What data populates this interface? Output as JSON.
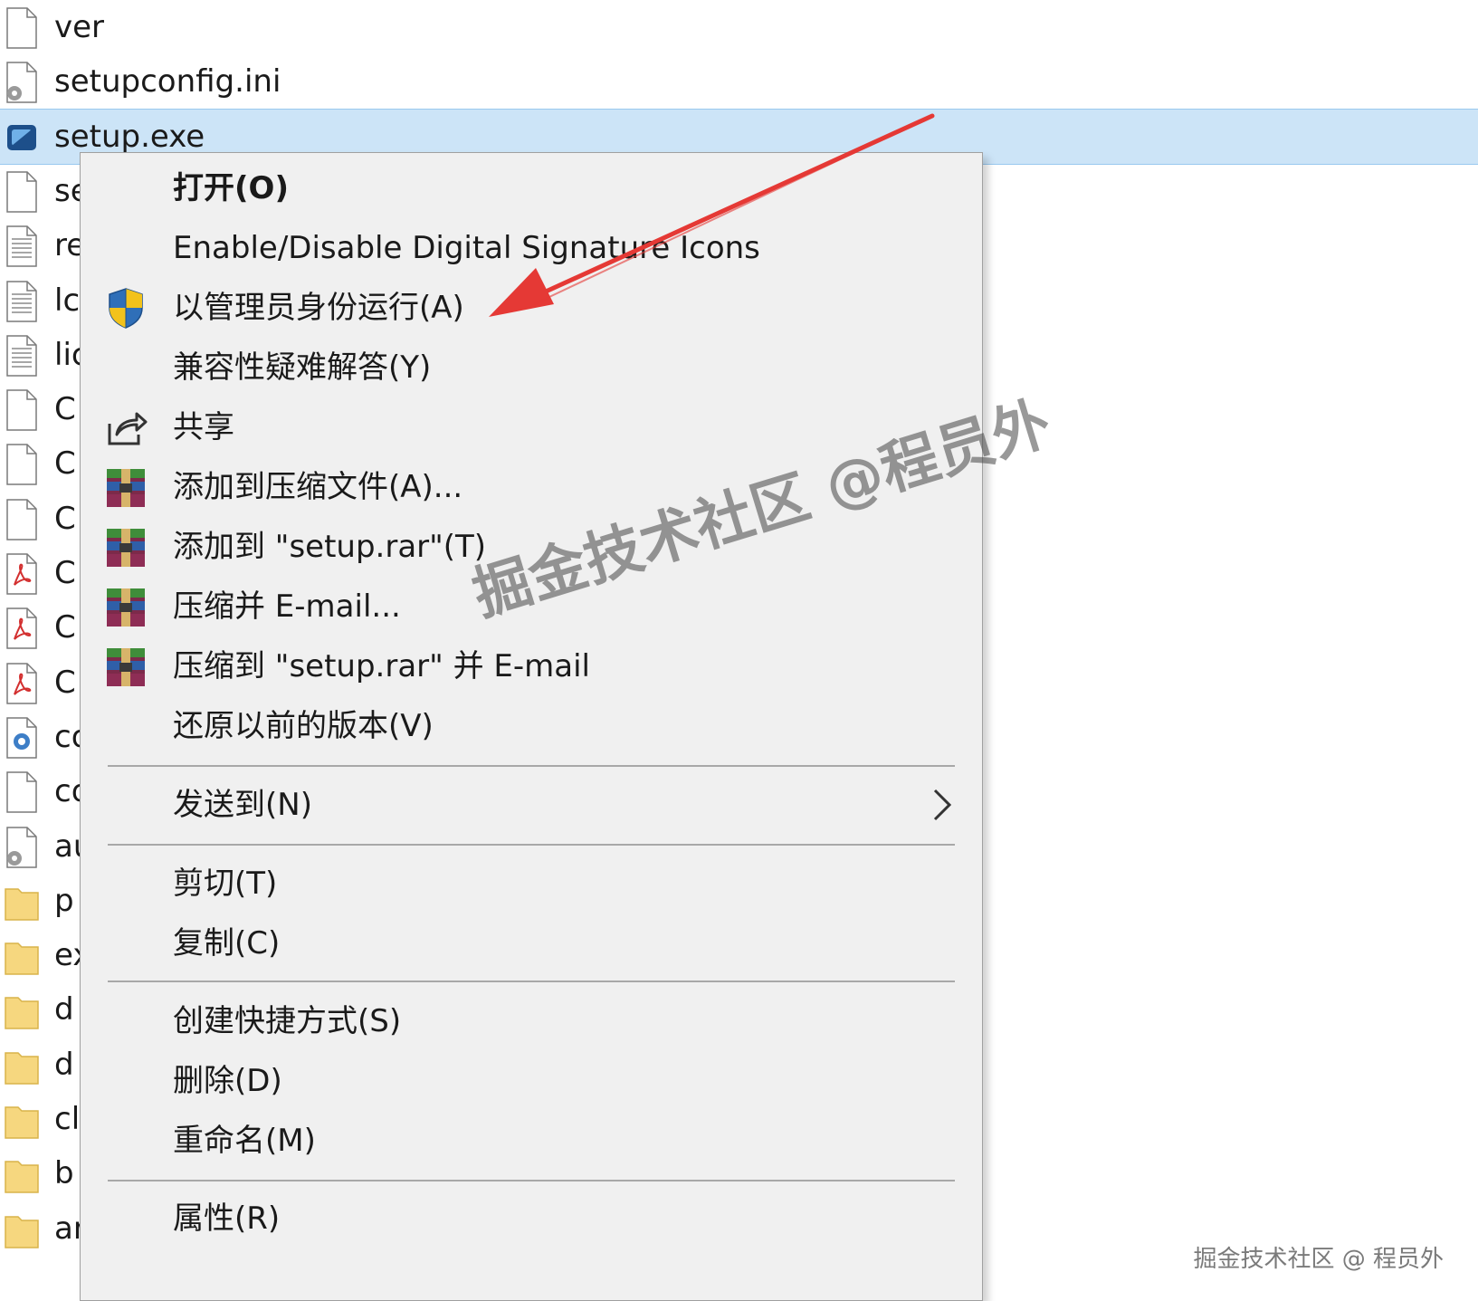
{
  "file_list": [
    {
      "name": "ver",
      "icon": "blank-file-icon"
    },
    {
      "name": "setupconfig.ini",
      "icon": "settings-file-icon"
    },
    {
      "name": "setup.exe",
      "icon": "installer-exe-icon",
      "selected": true
    },
    {
      "name": "se",
      "icon": "blank-file-icon"
    },
    {
      "name": "re",
      "icon": "text-file-icon"
    },
    {
      "name": "lc",
      "icon": "text-file-icon"
    },
    {
      "name": "lic",
      "icon": "text-file-icon"
    },
    {
      "name": "C",
      "icon": "blank-file-icon"
    },
    {
      "name": "C",
      "icon": "blank-file-icon"
    },
    {
      "name": "C",
      "icon": "blank-file-icon"
    },
    {
      "name": "C",
      "icon": "pdf-file-icon"
    },
    {
      "name": "C",
      "icon": "pdf-file-icon"
    },
    {
      "name": "C",
      "icon": "pdf-file-icon"
    },
    {
      "name": "co",
      "icon": "image-file-icon"
    },
    {
      "name": "co",
      "icon": "blank-file-icon"
    },
    {
      "name": "au",
      "icon": "settings-file-icon"
    },
    {
      "name": "p",
      "icon": "folder-icon"
    },
    {
      "name": "ex",
      "icon": "folder-icon"
    },
    {
      "name": "d",
      "icon": "folder-icon"
    },
    {
      "name": "d",
      "icon": "folder-icon"
    },
    {
      "name": "cl",
      "icon": "folder-icon"
    },
    {
      "name": "b",
      "icon": "folder-icon"
    },
    {
      "name": "ar",
      "icon": "folder-icon"
    }
  ],
  "context_menu": {
    "items": [
      {
        "label": "打开(O)",
        "bold": true,
        "icon": ""
      },
      {
        "label": "Enable/Disable Digital Signature Icons",
        "icon": ""
      },
      {
        "label": "以管理员身份运行(A)",
        "icon": "uac-shield-icon"
      },
      {
        "label": "兼容性疑难解答(Y)",
        "icon": ""
      },
      {
        "label": "共享",
        "icon": "share-icon"
      },
      {
        "label": "添加到压缩文件(A)...",
        "icon": "winrar-icon"
      },
      {
        "label": "添加到 \"setup.rar\"(T)",
        "icon": "winrar-icon"
      },
      {
        "label": "压缩并 E-mail...",
        "icon": "winrar-icon"
      },
      {
        "label": "压缩到 \"setup.rar\" 并 E-mail",
        "icon": "winrar-icon"
      },
      {
        "label": "还原以前的版本(V)",
        "icon": ""
      },
      {
        "label": "发送到(N)",
        "icon": "",
        "submenu": true
      },
      {
        "label": "剪切(T)",
        "icon": ""
      },
      {
        "label": "复制(C)",
        "icon": ""
      },
      {
        "label": "创建快捷方式(S)",
        "icon": ""
      },
      {
        "label": "删除(D)",
        "icon": ""
      },
      {
        "label": "重命名(M)",
        "icon": ""
      },
      {
        "label": "属性(R)",
        "icon": ""
      }
    ]
  },
  "annotation": {
    "color": "#e53935",
    "icon": "red-arrow-annotation"
  },
  "watermark": {
    "text": "掘金技术社区 @程员外"
  },
  "credit": {
    "text": "掘金技术社区 @ 程员外"
  },
  "colors": {
    "selection": "#cce4f7",
    "menu_bg": "#f0f0f0"
  }
}
